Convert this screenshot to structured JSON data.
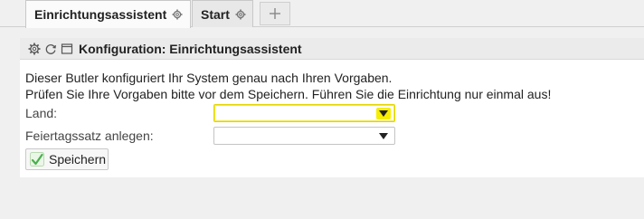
{
  "tabs": [
    {
      "label": "Einrichtungsassistent",
      "active": true,
      "icon": "gear-icon"
    },
    {
      "label": "Start",
      "active": false,
      "icon": "gear-icon"
    }
  ],
  "add_tab_icon": "plus-icon",
  "panel": {
    "title": "Konfiguration: Einrichtungsassistent",
    "header_icons": [
      "gear-icon",
      "refresh-icon",
      "window-icon"
    ]
  },
  "intro": {
    "line1": "Dieser Butler konfiguriert Ihr System genau nach Ihren Vorgaben.",
    "line2": "Prüfen Sie Ihre Vorgaben bitte vor dem Speichern. Führen Sie die Einrichtung nur einmal aus!"
  },
  "form": {
    "land": {
      "label": "Land:",
      "value": ""
    },
    "feiertagssatz": {
      "label": "Feiertagssatz anlegen:",
      "value": ""
    }
  },
  "save_button": {
    "label": "Speichern",
    "icon": "check-icon"
  },
  "colors": {
    "focus_yellow": "#f6ee00",
    "check_green": "#4caf50"
  }
}
